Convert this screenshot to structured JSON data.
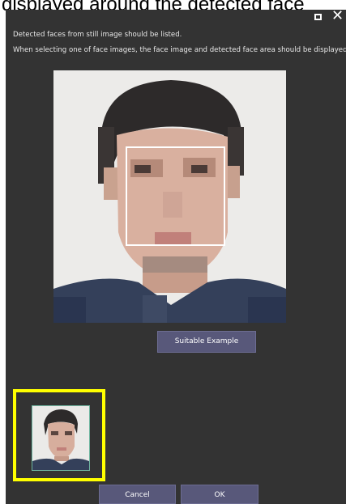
{
  "overlay": {
    "caption": "displayed around the detected face"
  },
  "window": {
    "maximize_icon": "maximize-icon",
    "close_icon": "close-icon",
    "close_glyph": "✕"
  },
  "messages": {
    "line1": "Detected faces from still image should be listed.",
    "line2": "When selecting one of face images, the face image and detected face area should be displayed."
  },
  "preview": {
    "face_box_color": "#ffffff"
  },
  "buttons": {
    "example_label": "Suitable Example",
    "cancel_label": "Cancel",
    "ok_label": "OK"
  },
  "face_list": {
    "selected_index": 0,
    "highlight_color": "#ffff00",
    "items": [
      {
        "selected": true
      }
    ]
  },
  "colors": {
    "dialog_bg": "#333333",
    "button_bg": "#58587a",
    "text": "#e8e8e8"
  }
}
